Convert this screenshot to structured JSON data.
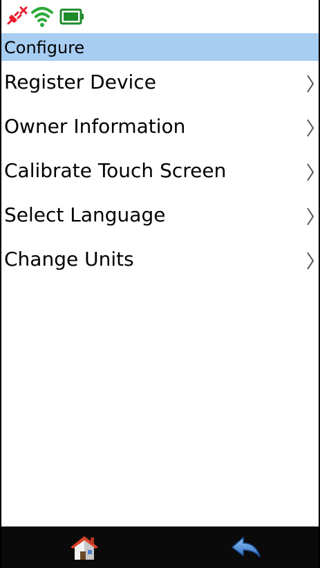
{
  "status_bar": {
    "icons": [
      "bluetooth-disconnected-icon",
      "wifi-icon",
      "battery-icon"
    ],
    "colors": {
      "disconnected": "#e81c2e",
      "wifi": "#2eaa3c",
      "battery": "#1e8a2a"
    }
  },
  "header": {
    "title": "Configure",
    "background": "#a7cdf2"
  },
  "menu": {
    "items": [
      {
        "label": "Register Device"
      },
      {
        "label": "Owner Information"
      },
      {
        "label": "Calibrate Touch Screen"
      },
      {
        "label": "Select Language"
      },
      {
        "label": "Change Units"
      }
    ]
  },
  "bottom_bar": {
    "buttons": [
      "home-icon",
      "back-arrow-icon"
    ],
    "background": "#0a0a0a"
  }
}
